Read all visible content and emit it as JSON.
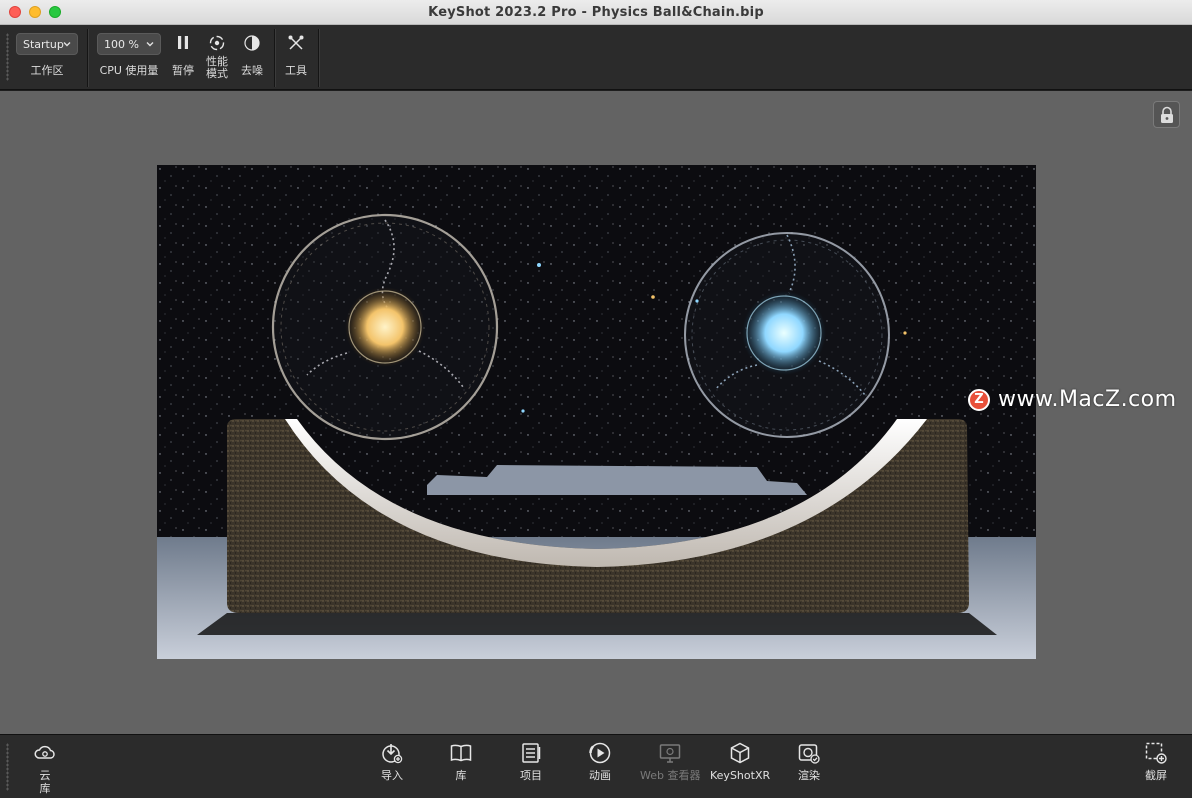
{
  "window": {
    "title": "KeyShot 2023.2 Pro  - Physics Ball&Chain.bip"
  },
  "toolbar": {
    "workspace_value": "Startup",
    "workspace_label": "工作区",
    "cpu_value": "100 %",
    "cpu_label": "CPU 使用量",
    "pause_label": "暂停",
    "performance_label_1": "性能",
    "performance_label_2": "模式",
    "denoise_label": "去噪",
    "tools_label": "工具"
  },
  "watermark": {
    "logo_letter": "Z",
    "text": "www.MacZ.com"
  },
  "ribbon": {
    "cloud_label_1": "云",
    "cloud_label_2": "库",
    "import_label": "导入",
    "library_label": "库",
    "project_label": "项目",
    "animation_label": "动画",
    "webviewer_label": "Web 查看器",
    "keyshotxr_label": "KeyShotXR",
    "render_label": "渲染",
    "screenshot_label": "截屏"
  },
  "colors": {
    "toolbar_bg": "#2b2b2b",
    "viewport_bg": "#636363",
    "accent_gold": "#f3c36a",
    "accent_cyan": "#8fd7ff"
  }
}
